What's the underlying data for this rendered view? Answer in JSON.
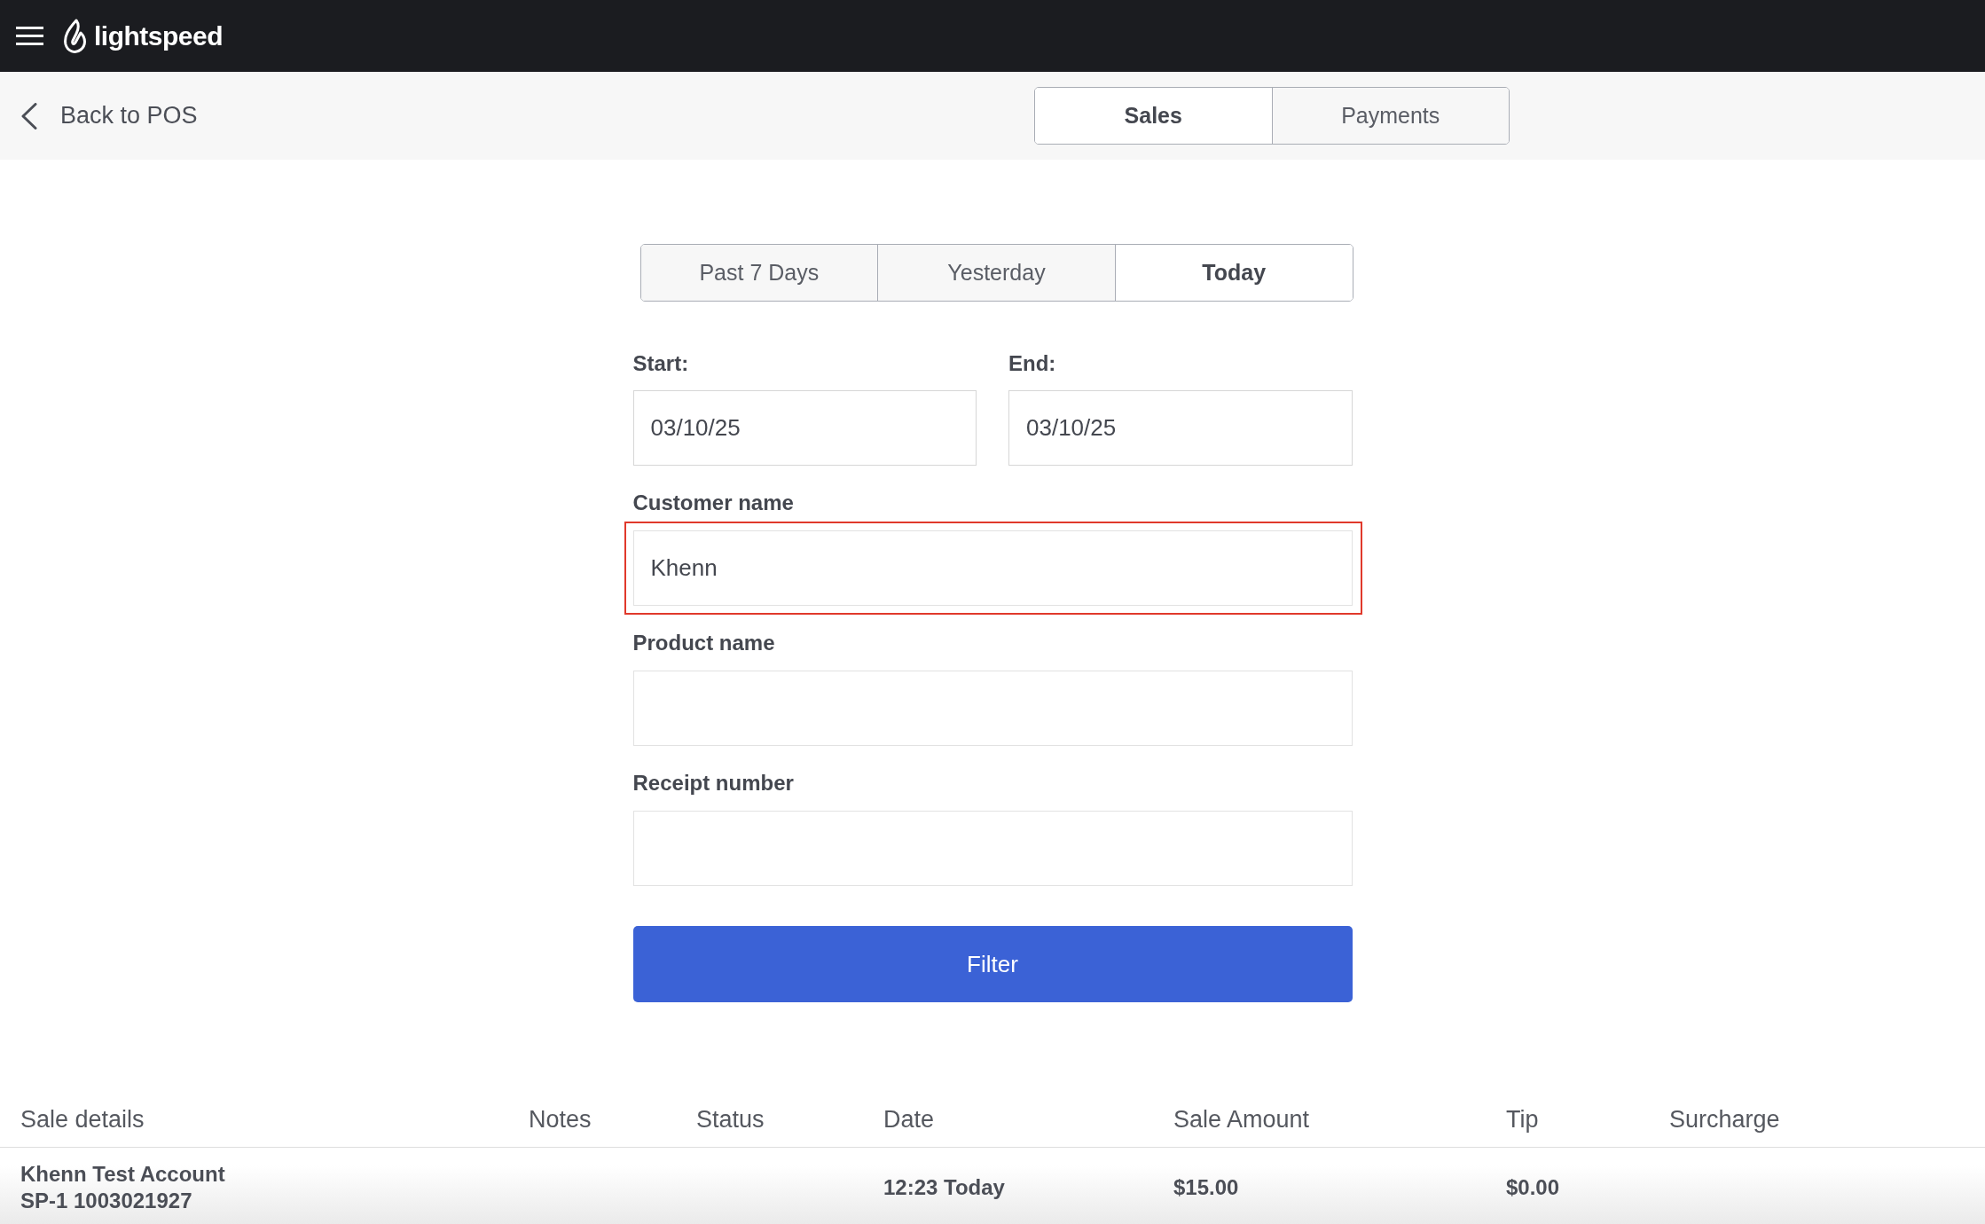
{
  "top_bar": {
    "logo_text": "lightspeed"
  },
  "back_link": {
    "label": "Back to POS"
  },
  "view_tabs": [
    {
      "label": "Sales",
      "selected": true
    },
    {
      "label": "Payments",
      "selected": false
    }
  ],
  "range_tabs": [
    {
      "label": "Past 7 Days",
      "selected": false
    },
    {
      "label": "Yesterday",
      "selected": false
    },
    {
      "label": "Today",
      "selected": true
    }
  ],
  "date_fields": [
    {
      "label": "Start:",
      "value": "03/10/25"
    },
    {
      "label": "End:",
      "value": "03/10/25"
    }
  ],
  "search_fields": [
    {
      "label": "Customer name",
      "value": "Khenn",
      "highlighted": true
    },
    {
      "label": "Product name",
      "highlighted": false
    },
    {
      "label": "Receipt number",
      "highlighted": false
    }
  ],
  "filter_button": {
    "label": "Filter"
  },
  "table": {
    "columns": [
      "Sale details",
      "Notes",
      "Status",
      "Date",
      "Sale Amount",
      "Tip",
      "Surcharge"
    ],
    "rows": [
      {
        "cells": [
          "Khenn Test Account\nSP-1 1003021927",
          "",
          "",
          "12:23 Today",
          "$15.00",
          "$0.00",
          ""
        ]
      }
    ]
  }
}
